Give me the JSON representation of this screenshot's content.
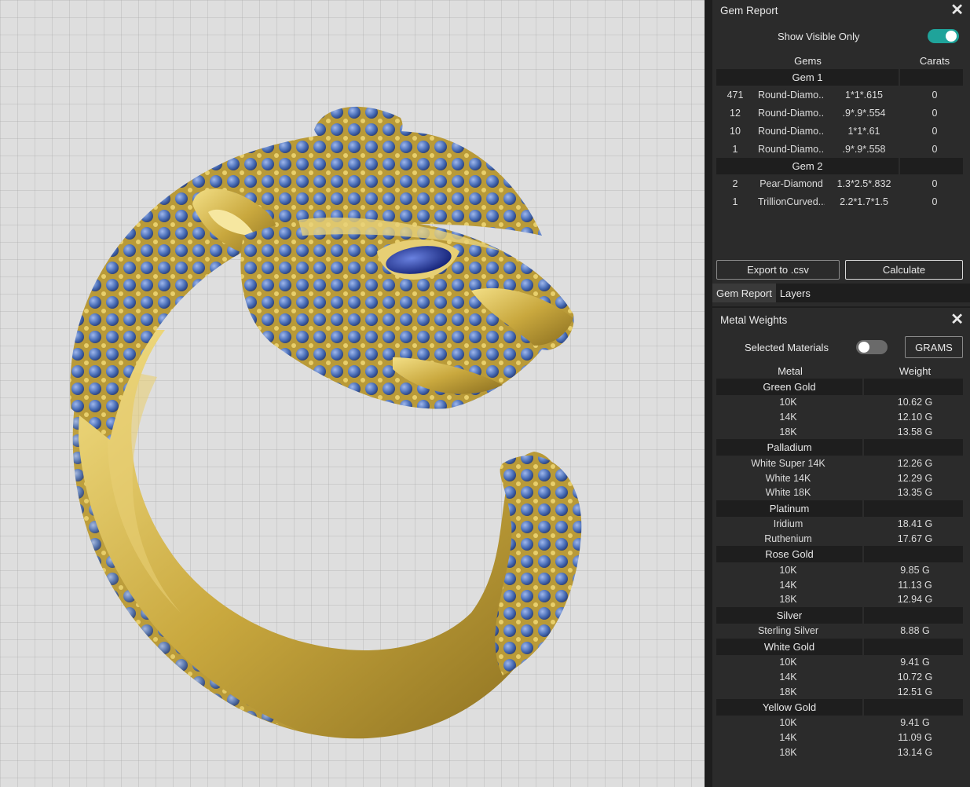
{
  "gem_report": {
    "title": "Gem Report",
    "show_visible_label": "Show Visible Only",
    "show_visible_on": true,
    "col_gems": "Gems",
    "col_carats": "Carats",
    "groups": [
      {
        "name": "Gem 1",
        "rows": [
          {
            "count": "471",
            "shape": "Round-Diamo...",
            "size": "1*1*.615",
            "carats": "0"
          },
          {
            "count": "12",
            "shape": "Round-Diamo...",
            "size": ".9*.9*.554",
            "carats": "0"
          },
          {
            "count": "10",
            "shape": "Round-Diamo...",
            "size": "1*1*.61",
            "carats": "0"
          },
          {
            "count": "1",
            "shape": "Round-Diamo...",
            "size": ".9*.9*.558",
            "carats": "0"
          }
        ]
      },
      {
        "name": "Gem 2",
        "rows": [
          {
            "count": "2",
            "shape": "Pear-Diamond",
            "size": "1.3*2.5*.832",
            "carats": "0"
          },
          {
            "count": "1",
            "shape": "TrillionCurved...",
            "size": "2.2*1.7*1.5",
            "carats": "0"
          }
        ]
      }
    ],
    "export_label": "Export to .csv",
    "calculate_label": "Calculate",
    "tabs": [
      "Gem Report",
      "Layers"
    ]
  },
  "metal_weights": {
    "title": "Metal Weights",
    "selected_label": "Selected Materials",
    "selected_on": false,
    "unit_button": "GRAMS",
    "col_metal": "Metal",
    "col_weight": "Weight",
    "groups": [
      {
        "name": "Green Gold",
        "rows": [
          [
            "10K",
            "10.62 G"
          ],
          [
            "14K",
            "12.10 G"
          ],
          [
            "18K",
            "13.58 G"
          ]
        ]
      },
      {
        "name": "Palladium",
        "rows": [
          [
            "White Super 14K",
            "12.26 G"
          ],
          [
            "White 14K",
            "12.29 G"
          ],
          [
            "White 18K",
            "13.35 G"
          ]
        ]
      },
      {
        "name": "Platinum",
        "rows": [
          [
            "Iridium",
            "18.41 G"
          ],
          [
            "Ruthenium",
            "17.67 G"
          ]
        ]
      },
      {
        "name": "Rose Gold",
        "rows": [
          [
            "10K",
            "9.85 G"
          ],
          [
            "14K",
            "11.13 G"
          ],
          [
            "18K",
            "12.94 G"
          ]
        ]
      },
      {
        "name": "Silver",
        "rows": [
          [
            "Sterling Silver",
            "8.88 G"
          ]
        ]
      },
      {
        "name": "White Gold",
        "rows": [
          [
            "10K",
            "9.41 G"
          ],
          [
            "14K",
            "10.72 G"
          ],
          [
            "18K",
            "12.51 G"
          ]
        ]
      },
      {
        "name": "Yellow Gold",
        "rows": [
          [
            "10K",
            "9.41 G"
          ],
          [
            "14K",
            "11.09 G"
          ],
          [
            "18K",
            "13.14 G"
          ]
        ]
      }
    ]
  },
  "colors": {
    "gold": "#c9a83e",
    "gem_blue": "#4a6fb8",
    "accent": "#1fa39a",
    "panel": "#2b2b2b"
  },
  "icons": [
    "close-icon"
  ]
}
